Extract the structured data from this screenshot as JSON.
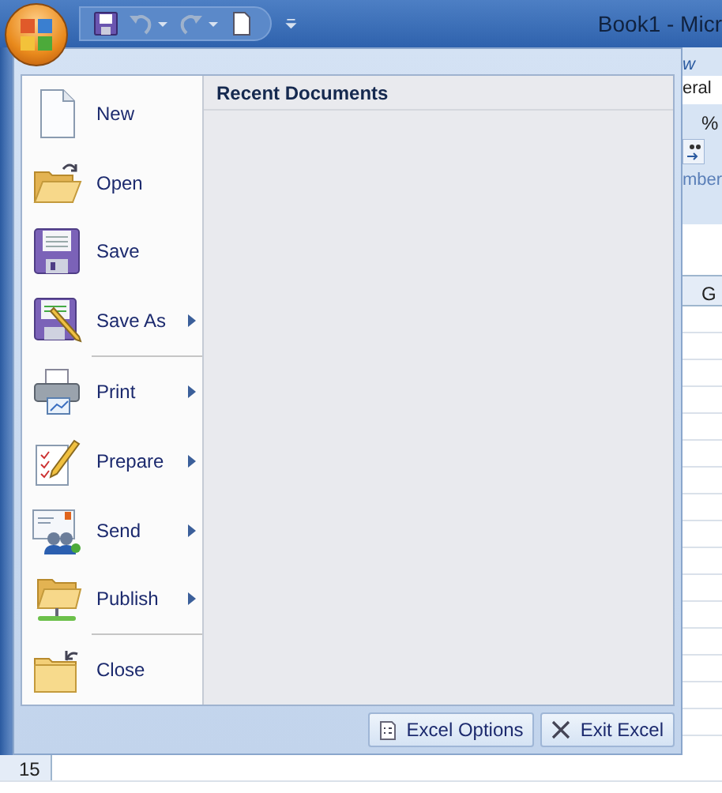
{
  "window": {
    "title": "Book1 - Micr"
  },
  "quick_access": [
    {
      "kind": "save",
      "disabled": false
    },
    {
      "kind": "undo",
      "disabled": true
    },
    {
      "kind": "redo",
      "disabled": true
    },
    {
      "kind": "new",
      "disabled": false
    }
  ],
  "menu": {
    "items": [
      {
        "kind": "new",
        "label": "New",
        "submenu": false,
        "divider_after": false
      },
      {
        "kind": "open",
        "label": "Open",
        "submenu": false,
        "divider_after": false
      },
      {
        "kind": "save",
        "label": "Save",
        "submenu": false,
        "divider_after": false
      },
      {
        "kind": "saveas",
        "label": "Save As",
        "submenu": true,
        "divider_after": true
      },
      {
        "kind": "print",
        "label": "Print",
        "submenu": true,
        "divider_after": false
      },
      {
        "kind": "prepare",
        "label": "Prepare",
        "submenu": true,
        "divider_after": false
      },
      {
        "kind": "send",
        "label": "Send",
        "submenu": true,
        "divider_after": false
      },
      {
        "kind": "publish",
        "label": "Publish",
        "submenu": true,
        "divider_after": true
      },
      {
        "kind": "close",
        "label": "Close",
        "submenu": false,
        "divider_after": false
      }
    ],
    "recent_documents": {
      "title": "Recent Documents"
    },
    "buttons": [
      {
        "kind": "options",
        "label": "Excel Options"
      },
      {
        "kind": "exit",
        "label": "Exit Excel"
      }
    ]
  },
  "ribbon_fragment": {
    "tab": "w",
    "number_format": "eral",
    "percent": "%",
    "group_label": "mber",
    "column_header": "G"
  },
  "row_headers": [
    "15"
  ]
}
